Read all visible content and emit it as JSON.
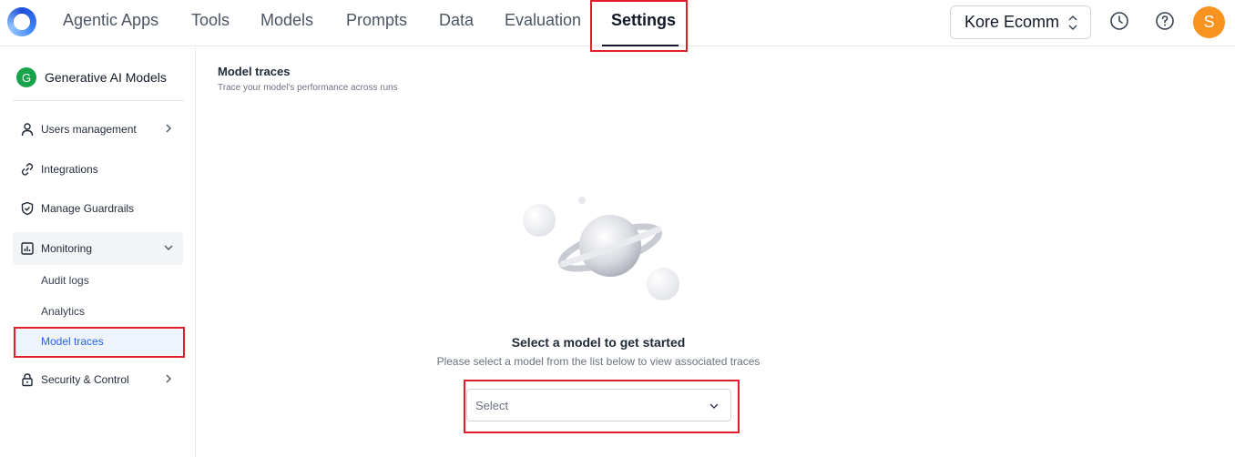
{
  "topnav": {
    "items": [
      "Agentic Apps",
      "Tools",
      "Models",
      "Prompts",
      "Data",
      "Evaluation",
      "Settings"
    ],
    "active": "Settings",
    "workspace": "Kore Ecomm",
    "avatar_initial": "S"
  },
  "sidebar": {
    "header": {
      "initial": "G",
      "title": "Generative AI Models"
    },
    "items": [
      {
        "label": "Users management",
        "icon": "user-icon"
      },
      {
        "label": "Integrations",
        "icon": "link-icon"
      },
      {
        "label": "Manage Guardrails",
        "icon": "shield-icon"
      },
      {
        "label": "Monitoring",
        "icon": "chart-icon"
      },
      {
        "label": "Security & Control",
        "icon": "lock-icon"
      }
    ],
    "monitoring_sub": [
      "Audit logs",
      "Analytics",
      "Model traces"
    ],
    "active_sub": "Model traces"
  },
  "main": {
    "title": "Model traces",
    "subtitle": "Trace your model's performance across runs",
    "empty_title": "Select a model to get started",
    "empty_subtitle": "Please select a model from the list below to view associated traces",
    "select_placeholder": "Select"
  },
  "colors": {
    "highlight": "#e11d2a",
    "accent": "#2563eb",
    "avatar": "#f7931e",
    "sidebar_badge": "#16a34a"
  }
}
